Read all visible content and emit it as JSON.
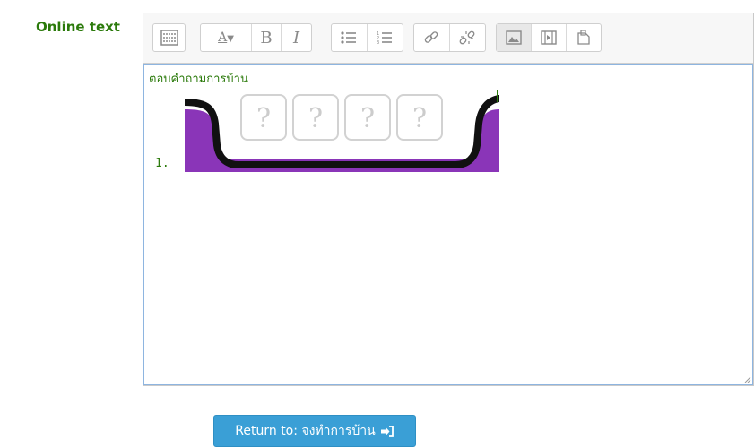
{
  "field": {
    "label": "Online text"
  },
  "editor": {
    "toolbar": {
      "groups": [
        [
          "toolbar-toggle-icon"
        ],
        [
          "font-style-icon",
          "bold-icon",
          "italic-icon"
        ],
        [
          "bullet-list-icon",
          "numbered-list-icon"
        ],
        [
          "link-icon",
          "unlink-icon"
        ],
        [
          "image-icon",
          "media-icon",
          "manage-files-icon"
        ]
      ],
      "bold_label": "B",
      "italic_label": "I",
      "font_label": "A"
    },
    "content": {
      "text": "ตอบคำถามการบ้าน",
      "list_number": "1."
    }
  },
  "actions": {
    "return_label": "Return to: จงทำการบ้าน",
    "return_icon": "sign-in-icon"
  },
  "colors": {
    "label_green": "#2b7a0b",
    "button_blue": "#3a9fd6",
    "image_purple": "#8a35b8"
  }
}
